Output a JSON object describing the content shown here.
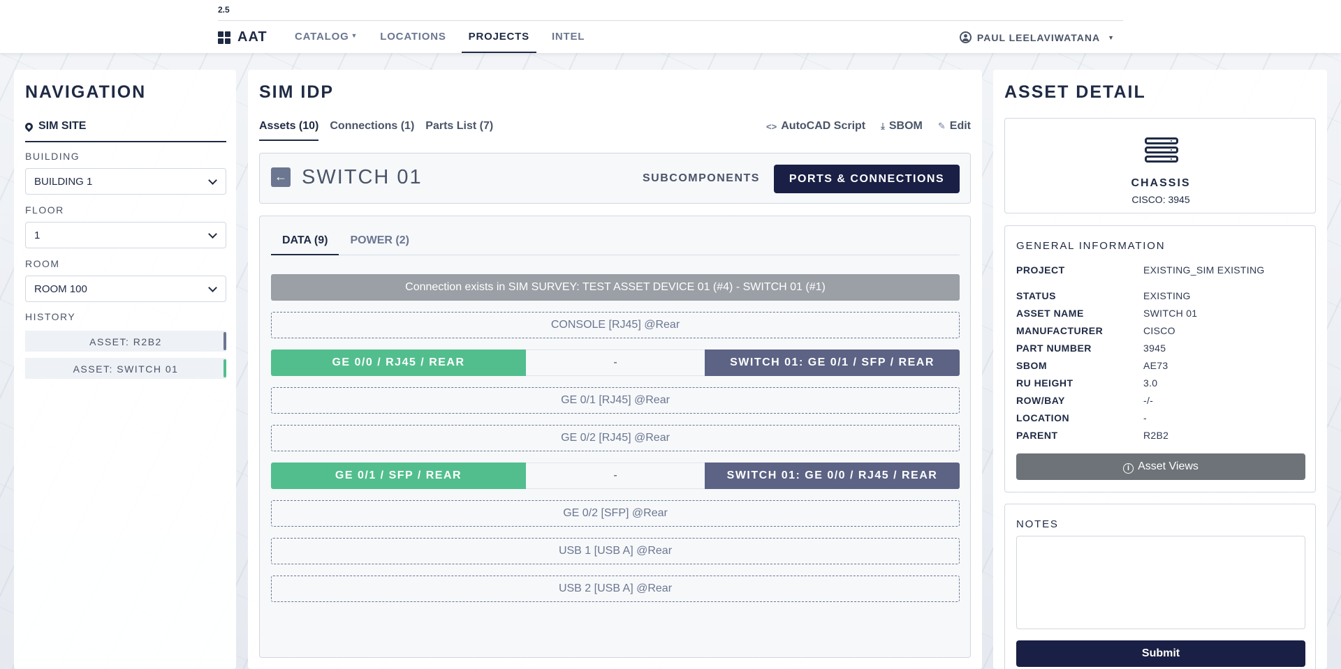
{
  "app": {
    "version": "2.5",
    "brand": "AAT",
    "nav": [
      {
        "label": "CATALOG"
      },
      {
        "label": "LOCATIONS"
      },
      {
        "label": "PROJECTS"
      },
      {
        "label": "INTEL"
      }
    ],
    "user": "PAUL LEELAVIWATANA"
  },
  "navigation": {
    "title": "NAVIGATION",
    "site": "SIM SITE",
    "building_label": "BUILDING",
    "building_value": "BUILDING 1",
    "floor_label": "FLOOR",
    "floor_value": "1",
    "room_label": "ROOM",
    "room_value": "ROOM 100",
    "history_label": "HISTORY",
    "history": [
      {
        "label": "ASSET: R2B2",
        "color": "#6b7690"
      },
      {
        "label": "ASSET: SWITCH 01",
        "color": "#52be8d"
      }
    ]
  },
  "project": {
    "title": "SIM IDP",
    "tabs": [
      {
        "label": "Assets (10)"
      },
      {
        "label": "Connections (1)"
      },
      {
        "label": "Parts List (7)"
      }
    ],
    "actions": [
      {
        "label": "AutoCAD Script",
        "icon": "code-icon"
      },
      {
        "label": "SBOM",
        "icon": "download-icon"
      },
      {
        "label": "Edit",
        "icon": "pencil-icon"
      }
    ],
    "device_title": "SWITCH 01",
    "subcomponents_label": "SUBCOMPONENTS",
    "ports_label": "PORTS & CONNECTIONS",
    "subtabs": [
      {
        "label": "DATA (9)"
      },
      {
        "label": "POWER (2)"
      }
    ],
    "exists_banner": "Connection exists in SIM SURVEY: TEST ASSET DEVICE 01 (#4) - SWITCH 01 (#1)",
    "ports": [
      {
        "type": "empty",
        "label": "CONSOLE [RJ45] @Rear"
      },
      {
        "type": "connected",
        "left": "GE 0/0 / RJ45 / REAR",
        "mid": "-",
        "right": "SWITCH 01: GE 0/1 / SFP / REAR"
      },
      {
        "type": "empty",
        "label": "GE 0/1 [RJ45] @Rear"
      },
      {
        "type": "empty",
        "label": "GE 0/2 [RJ45] @Rear"
      },
      {
        "type": "connected",
        "left": "GE 0/1 / SFP / REAR",
        "mid": "-",
        "right": "SWITCH 01: GE 0/0 / RJ45 / REAR"
      },
      {
        "type": "empty",
        "label": "GE 0/2 [SFP] @Rear"
      },
      {
        "type": "empty",
        "label": "USB 1 [USB A] @Rear"
      },
      {
        "type": "empty",
        "label": "USB 2 [USB A] @Rear"
      }
    ]
  },
  "asset": {
    "title": "ASSET DETAIL",
    "type": "CHASSIS",
    "model": "CISCO: 3945",
    "general_title": "GENERAL INFORMATION",
    "info": [
      {
        "key": "PROJECT",
        "value": "EXISTING_SIM EXISTING"
      },
      {
        "key": "STATUS",
        "value": "EXISTING"
      },
      {
        "key": "ASSET NAME",
        "value": "SWITCH 01"
      },
      {
        "key": "MANUFACTURER",
        "value": "CISCO"
      },
      {
        "key": "PART NUMBER",
        "value": "3945"
      },
      {
        "key": "SBOM",
        "value": "AE73"
      },
      {
        "key": "RU HEIGHT",
        "value": "3.0"
      },
      {
        "key": "ROW/BAY",
        "value": "-/-"
      },
      {
        "key": "LOCATION",
        "value": "-"
      },
      {
        "key": "PARENT",
        "value": "R2B2"
      }
    ],
    "views_label": "Asset Views",
    "notes_title": "NOTES",
    "notes_value": "",
    "submit_label": "Submit"
  }
}
